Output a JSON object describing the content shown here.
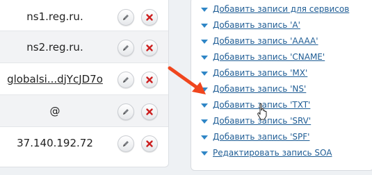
{
  "records": [
    {
      "value": "ns1.reg.ru."
    },
    {
      "value": "ns2.reg.ru."
    },
    {
      "value": "globalsi...djYcJD7o"
    },
    {
      "value": "@"
    },
    {
      "value": "37.140.192.72"
    }
  ],
  "menu": [
    {
      "label": "Добавить записи для сервисов"
    },
    {
      "label": "Добавить запись 'A'"
    },
    {
      "label": "Добавить запись 'AAAA'"
    },
    {
      "label": "Добавить запись 'CNAME'"
    },
    {
      "label": "Добавить запись 'MX'"
    },
    {
      "label": "Добавить запись 'NS'"
    },
    {
      "label": "Добавить запись 'TXT'"
    },
    {
      "label": "Добавить запись 'SRV'"
    },
    {
      "label": "Добавить запись 'SPF'"
    },
    {
      "label": "Редактировать запись SOA"
    }
  ],
  "colors": {
    "link": "#1f5d95",
    "triangle": "#2f86c6",
    "delete": "#cc1f1f",
    "arrow": "#f0461e"
  },
  "icons": {
    "edit": "pencil-icon",
    "delete": "x-icon",
    "menu": "triangle-down-icon",
    "pointer": "mouse-cursor-icon"
  }
}
